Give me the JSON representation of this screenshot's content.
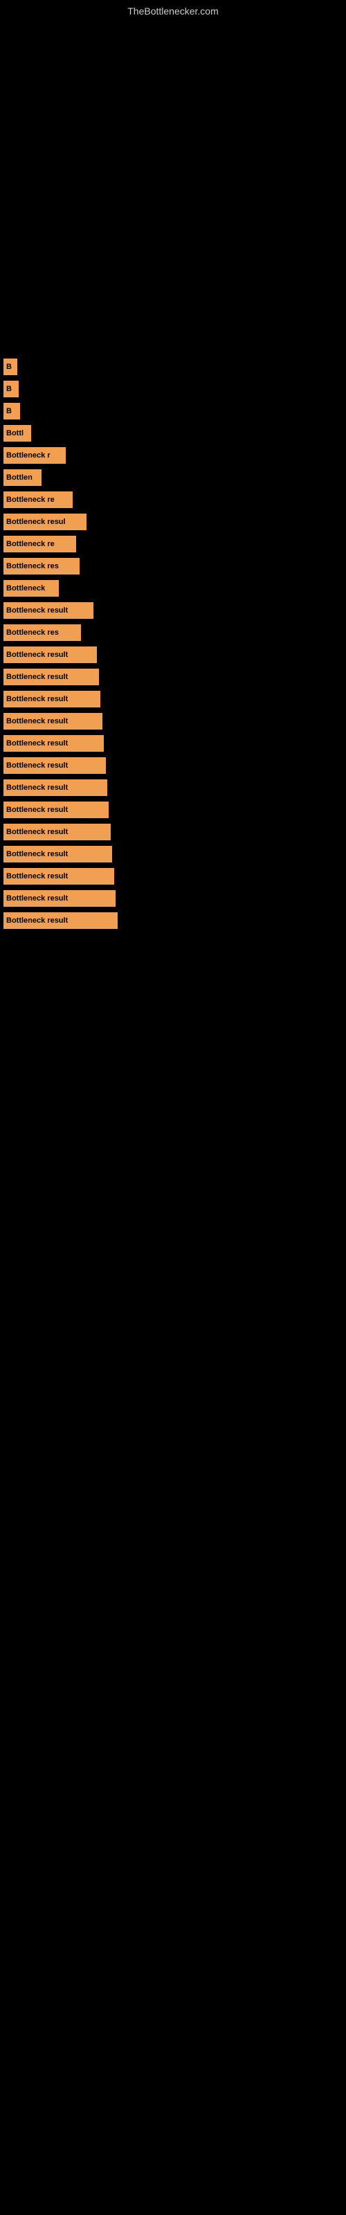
{
  "site": {
    "title": "TheBottlenecker.com"
  },
  "results": [
    {
      "label": "B",
      "width": 20,
      "text": "B"
    },
    {
      "label": "B",
      "width": 22,
      "text": "B"
    },
    {
      "label": "B",
      "width": 24,
      "text": "B"
    },
    {
      "label": "Bottl",
      "width": 40,
      "text": "Bottl"
    },
    {
      "label": "Bottleneck r",
      "width": 90,
      "text": "Bottleneck r"
    },
    {
      "label": "Bottlen",
      "width": 55,
      "text": "Bottlen"
    },
    {
      "label": "Bottleneck re",
      "width": 100,
      "text": "Bottleneck re"
    },
    {
      "label": "Bottleneck resul",
      "width": 120,
      "text": "Bottleneck resul"
    },
    {
      "label": "Bottleneck re",
      "width": 105,
      "text": "Bottleneck re"
    },
    {
      "label": "Bottleneck res",
      "width": 110,
      "text": "Bottleneck res"
    },
    {
      "label": "Bottleneck",
      "width": 80,
      "text": "Bottleneck"
    },
    {
      "label": "Bottleneck result",
      "width": 130,
      "text": "Bottleneck result"
    },
    {
      "label": "Bottleneck res",
      "width": 112,
      "text": "Bottleneck res"
    },
    {
      "label": "Bottleneck result",
      "width": 135,
      "text": "Bottleneck result"
    },
    {
      "label": "Bottleneck result",
      "width": 138,
      "text": "Bottleneck result"
    },
    {
      "label": "Bottleneck result",
      "width": 140,
      "text": "Bottleneck result"
    },
    {
      "label": "Bottleneck result",
      "width": 143,
      "text": "Bottleneck result"
    },
    {
      "label": "Bottleneck result",
      "width": 145,
      "text": "Bottleneck result"
    },
    {
      "label": "Bottleneck result",
      "width": 148,
      "text": "Bottleneck result"
    },
    {
      "label": "Bottleneck result",
      "width": 150,
      "text": "Bottleneck result"
    },
    {
      "label": "Bottleneck result",
      "width": 152,
      "text": "Bottleneck result"
    },
    {
      "label": "Bottleneck result",
      "width": 155,
      "text": "Bottleneck result"
    },
    {
      "label": "Bottleneck result",
      "width": 157,
      "text": "Bottleneck result"
    },
    {
      "label": "Bottleneck result",
      "width": 160,
      "text": "Bottleneck result"
    },
    {
      "label": "Bottleneck result",
      "width": 162,
      "text": "Bottleneck result"
    },
    {
      "label": "Bottleneck result",
      "width": 165,
      "text": "Bottleneck result"
    }
  ]
}
